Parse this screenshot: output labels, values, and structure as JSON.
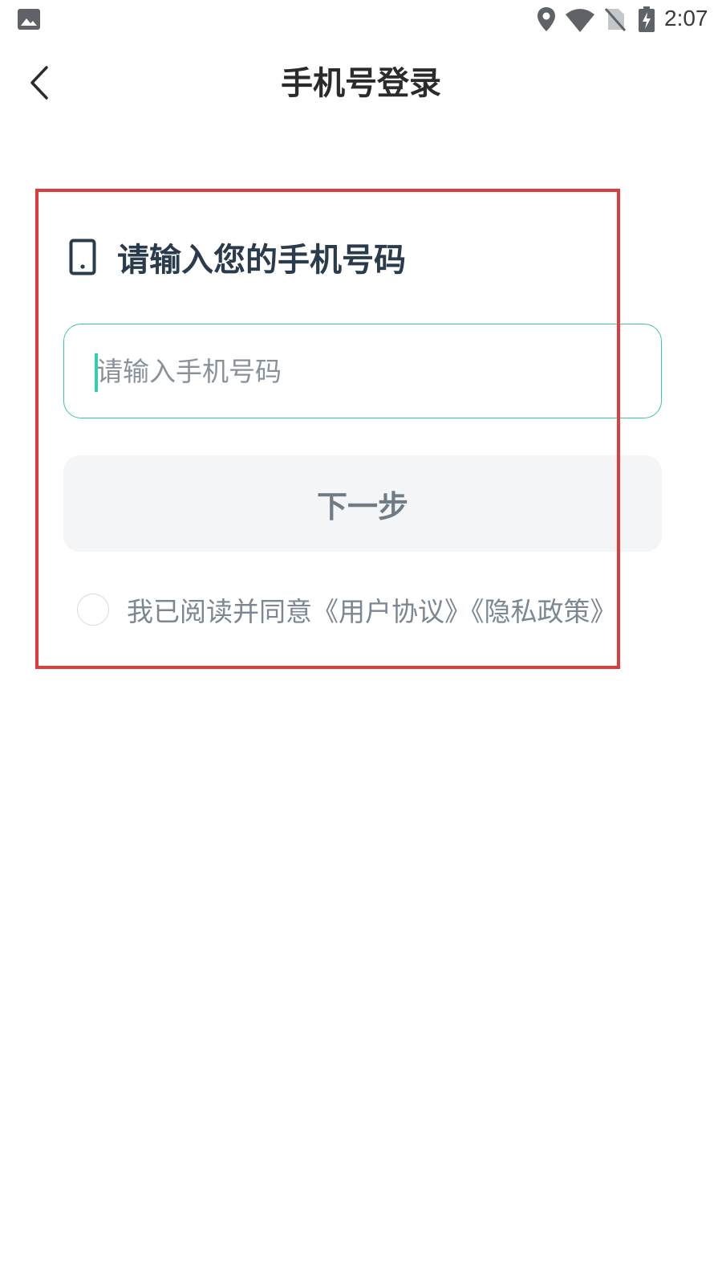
{
  "status_bar": {
    "time": "2:07",
    "icons": [
      "image-icon",
      "location-icon",
      "wifi-icon",
      "no-sim-icon",
      "battery-charging-icon"
    ]
  },
  "header": {
    "title": "手机号登录",
    "back_icon": "chevron-left-icon"
  },
  "form": {
    "section_title": "请输入您的手机号码",
    "section_icon": "phone-icon",
    "phone_input": {
      "value": "",
      "placeholder": "请输入手机号码"
    },
    "next_button_label": "下一步",
    "agreement": {
      "checked": false,
      "prefix": "我已阅读并同意",
      "user_agreement": "《用户协议》",
      "privacy_policy": "《隐私政策》"
    }
  },
  "colors": {
    "accent": "#3cc7a7",
    "caret": "#2fd0b0",
    "title": "#2a3b4c",
    "button_bg": "#f4f5f7",
    "button_text": "#6f7c86",
    "annotation_frame": "#e03c3c"
  }
}
